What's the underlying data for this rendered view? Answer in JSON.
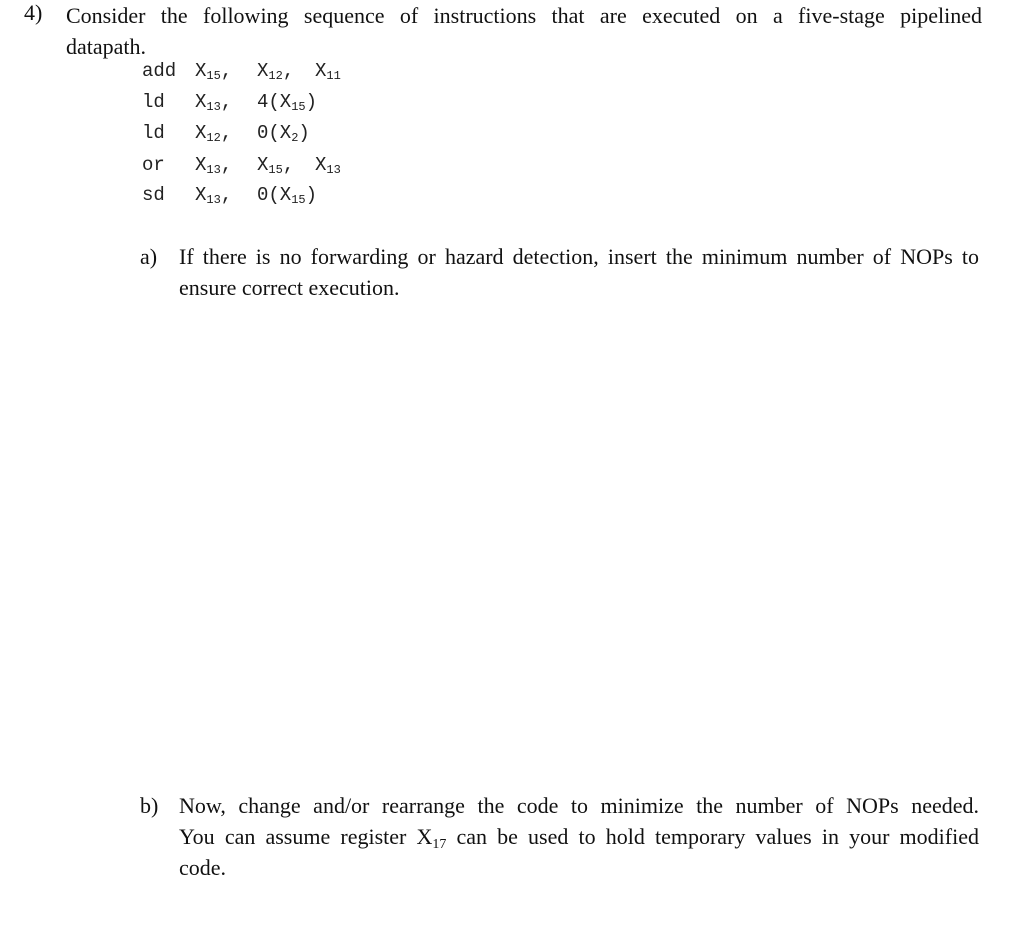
{
  "question": {
    "number": "4)",
    "line1": "Consider the following sequence of instructions that are executed on a five-stage pipelined",
    "line2": "datapath."
  },
  "code": [
    {
      "op": "add",
      "a1": "X",
      "a1_sub": "15",
      "a1_suf": ",",
      "a2": "X",
      "a2_sub": "12",
      "a2_suf": ",",
      "a3": "X",
      "a3_sub": "11"
    },
    {
      "op": "ld",
      "a1": "X",
      "a1_sub": "13",
      "a1_suf": ",",
      "a2": "4(X",
      "a2_sub": "15",
      "a2_suf": ")"
    },
    {
      "op": "ld",
      "a1": "X",
      "a1_sub": "12",
      "a1_suf": ",",
      "a2": "0(X",
      "a2_sub": "2",
      "a2_suf": ")"
    },
    {
      "op": "or",
      "a1": "X",
      "a1_sub": "13",
      "a1_suf": ",",
      "a2": "X",
      "a2_sub": "15",
      "a2_suf": ",",
      "a3": "X",
      "a3_sub": "13"
    },
    {
      "op": "sd",
      "a1": "X",
      "a1_sub": "13",
      "a1_suf": ",",
      "a2": "0(X",
      "a2_sub": "15",
      "a2_suf": ")"
    }
  ],
  "part_a": {
    "label": "a)",
    "line1": "If there is no forwarding or hazard detection, insert the minimum number of NOPs to",
    "line2": "ensure correct execution."
  },
  "part_b": {
    "label": "b)",
    "line1": "Now, change and/or rearrange the code to minimize the number of NOPs needed.",
    "line2_pre": "You can assume register X",
    "line2_sub": "17",
    "line2_post": " can be used to hold temporary values in your modified",
    "line3": "code."
  }
}
